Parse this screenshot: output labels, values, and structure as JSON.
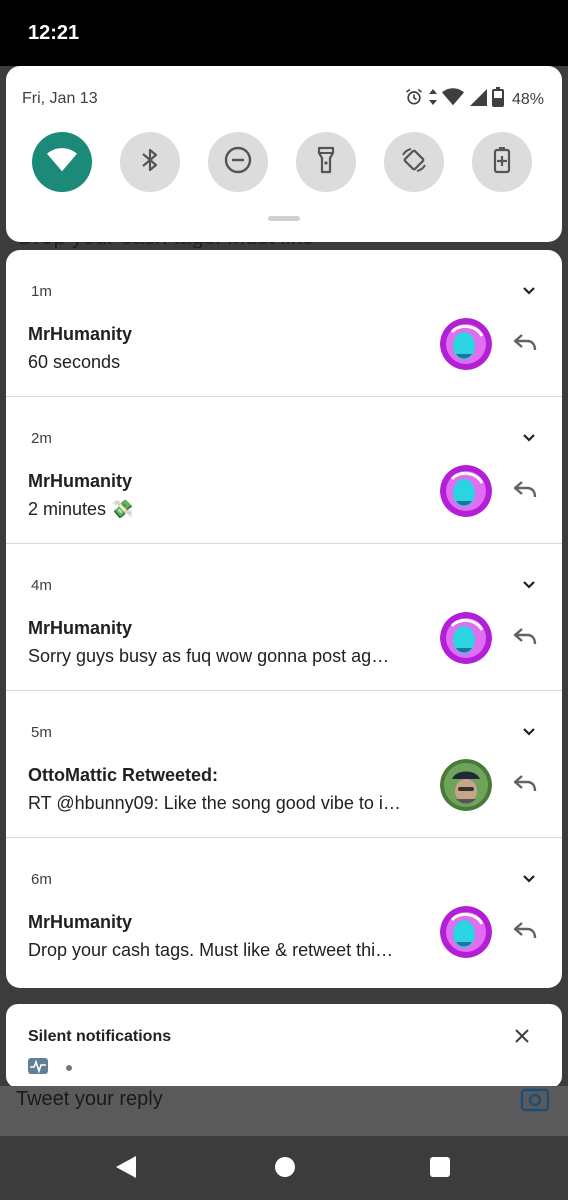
{
  "status_bar": {
    "time": "12:21"
  },
  "background_app": {
    "partial_text": "Drop your cash tags. Must like",
    "reply_placeholder": "Tweet your reply"
  },
  "quick_settings": {
    "date": "Fri, Jan 13",
    "battery_percent": "48%",
    "tiles": [
      {
        "name": "wifi",
        "active": true
      },
      {
        "name": "bluetooth",
        "active": false
      },
      {
        "name": "do-not-disturb",
        "active": false
      },
      {
        "name": "flashlight",
        "active": false
      },
      {
        "name": "auto-rotate",
        "active": false
      },
      {
        "name": "battery-saver",
        "active": false
      }
    ],
    "active_color": "#1b8a79"
  },
  "notifications": [
    {
      "time": "1m",
      "title": "MrHumanity",
      "body": "60 seconds",
      "avatar": "mrhumanity-avatar"
    },
    {
      "time": "2m",
      "title": "MrHumanity",
      "body": "2 minutes 💸",
      "avatar": "mrhumanity-avatar"
    },
    {
      "time": "4m",
      "title": "MrHumanity",
      "body": "Sorry guys busy as fuq wow gonna post ag…",
      "avatar": "mrhumanity-avatar"
    },
    {
      "time": "5m",
      "title": "OttoMattic Retweeted:",
      "body": "RT @hbunny09: Like the song good vibe to i…",
      "avatar": "ottomattic-avatar"
    },
    {
      "time": "6m",
      "title": "MrHumanity",
      "body": "Drop your cash tags. Must like & retweet thi…",
      "avatar": "mrhumanity-avatar"
    }
  ],
  "silent_section": {
    "heading": "Silent notifications"
  }
}
